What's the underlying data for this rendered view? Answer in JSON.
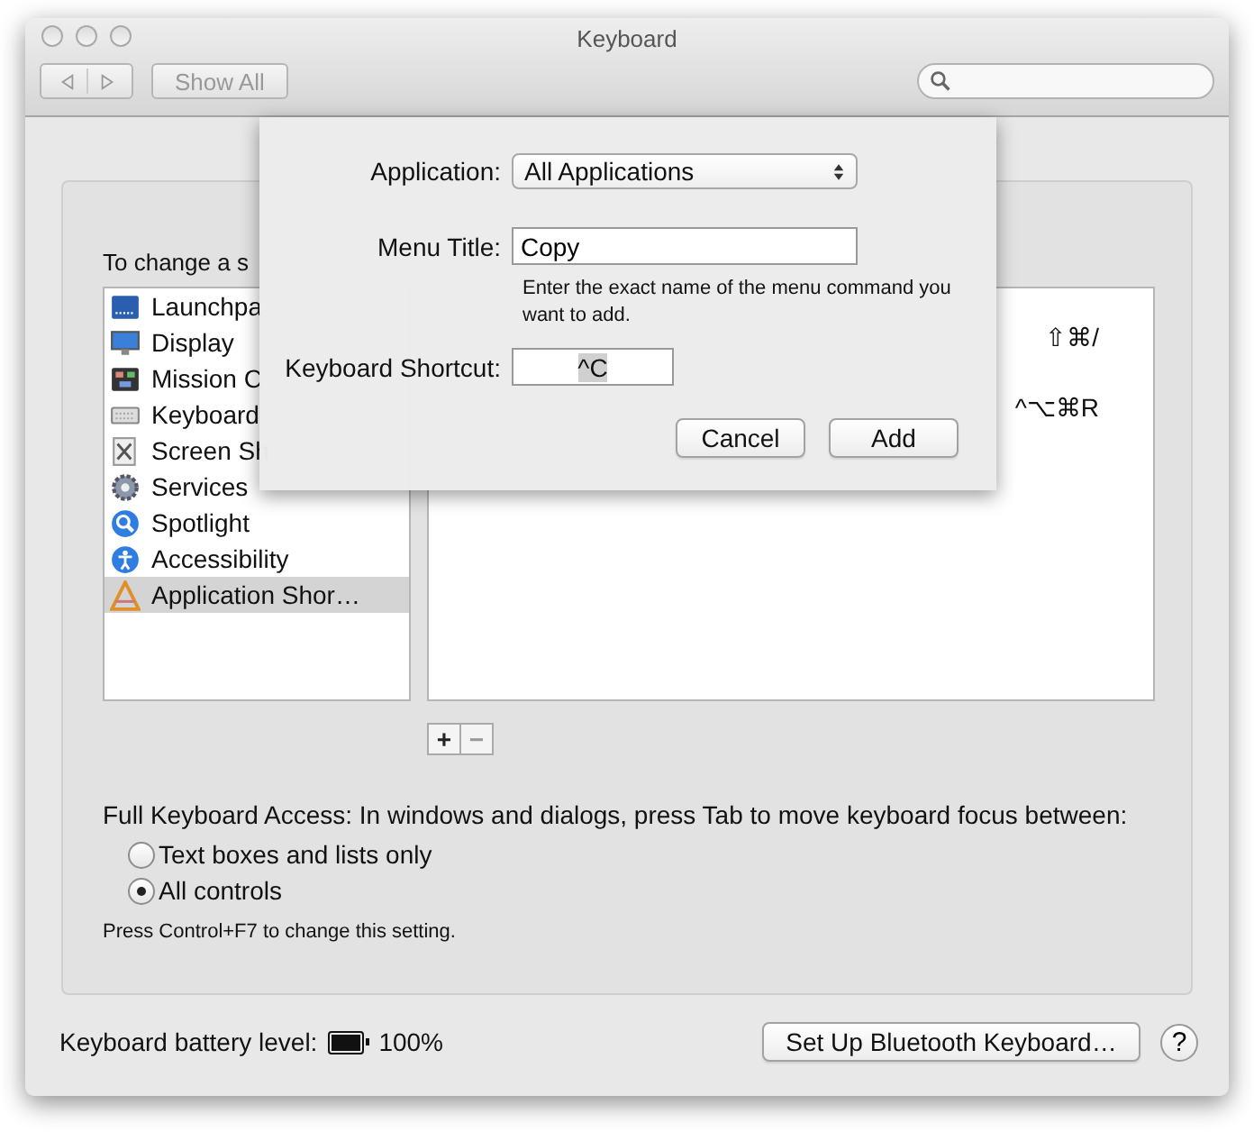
{
  "window": {
    "title": "Keyboard"
  },
  "toolbar": {
    "show_all": "Show All"
  },
  "instructions": "To change a s",
  "categories": [
    {
      "label": "Launchpa",
      "kind": "launchpad",
      "selected": false
    },
    {
      "label": "Display",
      "kind": "display",
      "selected": false
    },
    {
      "label": "Mission C",
      "kind": "mission",
      "selected": false
    },
    {
      "label": "Keyboard",
      "kind": "keyboard",
      "selected": false
    },
    {
      "label": "Screen Sh",
      "kind": "screenshot",
      "selected": false
    },
    {
      "label": "Services",
      "kind": "gear",
      "selected": false
    },
    {
      "label": "Spotlight",
      "kind": "spotlight",
      "selected": false
    },
    {
      "label": "Accessibility",
      "kind": "accessibility",
      "selected": false
    },
    {
      "label": "Application Shor…",
      "kind": "appshortcuts",
      "selected": true
    }
  ],
  "shortcuts": [
    {
      "keys": "⇧⌘/"
    },
    {
      "keys": "^⌥⌘R"
    }
  ],
  "list_buttons": [
    "+",
    "−"
  ],
  "full_keyboard_access": {
    "label": "Full Keyboard Access: In windows and dialogs, press Tab to move keyboard focus between:",
    "options": [
      {
        "label": "Text boxes and lists only",
        "selected": false
      },
      {
        "label": "All controls",
        "selected": true
      }
    ],
    "note": "Press Control+F7 to change this setting."
  },
  "battery": {
    "label": "Keyboard battery level:",
    "level": 1,
    "reading": "100%"
  },
  "bluetooth_button": "Set Up Bluetooth Keyboard…",
  "help_button": "?",
  "sheet": {
    "application": {
      "label": "Application:",
      "value": "All Applications"
    },
    "menu_title": {
      "label": "Menu Title:",
      "value": "Copy"
    },
    "hint": "Enter the exact name of the menu command you want to add.",
    "shortcut": {
      "label": "Keyboard Shortcut:",
      "value": "^C"
    },
    "buttons": [
      "Cancel",
      "Add"
    ]
  }
}
